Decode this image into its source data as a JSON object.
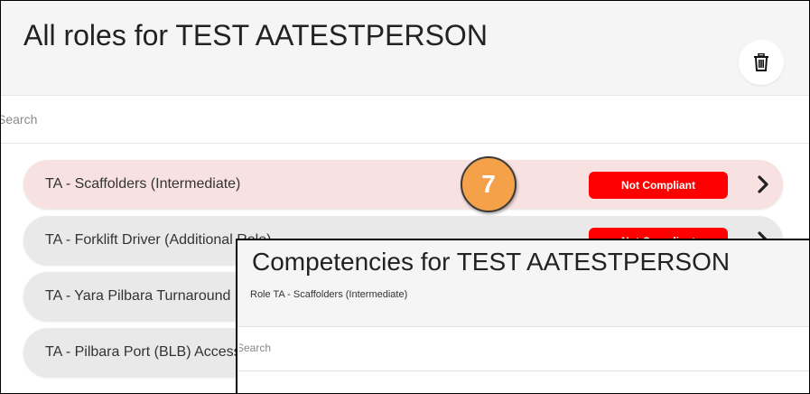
{
  "main": {
    "title": "All roles for TEST AATESTPERSON",
    "delete_icon": "trash-icon",
    "search": {
      "placeholder": "Search",
      "value": ""
    }
  },
  "roles": [
    {
      "label": "TA - Scaffolders (Intermediate)",
      "status": "Not Compliant",
      "selected": true
    },
    {
      "label": "TA - Forklift Driver (Additional Role)",
      "status": "Not Compliant",
      "selected": false
    },
    {
      "label": "TA - Yara Pilbara Turnaround",
      "status": "",
      "selected": false
    },
    {
      "label": "TA - Pilbara Port (BLB) Access",
      "status": "",
      "selected": false
    }
  ],
  "step_marker": {
    "number": "7"
  },
  "competencies_panel": {
    "title": "Competencies for TEST AATESTPERSON",
    "subtitle": "Role TA - Scaffolders (Intermediate)",
    "search": {
      "placeholder": "Search",
      "value": ""
    }
  },
  "colors": {
    "status_not_compliant": "#ff0000",
    "selected_row": "#f8e1e1",
    "row": "#e9e9e9",
    "step_marker": "#f5a14a"
  }
}
